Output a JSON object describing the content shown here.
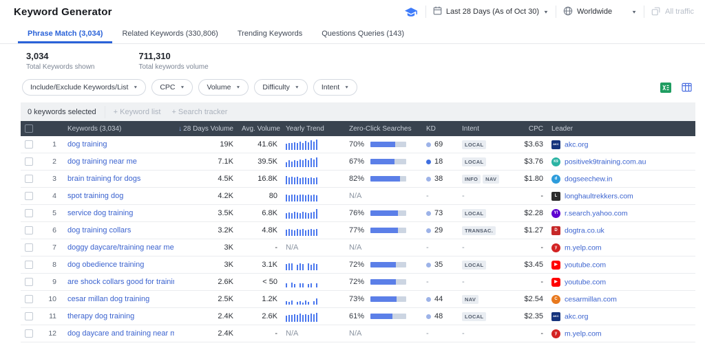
{
  "header": {
    "title": "Keyword Generator",
    "date_range": "Last 28 Days (As of Oct 30)",
    "location": "Worldwide",
    "traffic_filter": "All traffic"
  },
  "tabs": [
    {
      "label": "Phrase Match (3,034)",
      "active": true
    },
    {
      "label": "Related Keywords (330,806)",
      "active": false
    },
    {
      "label": "Trending Keywords",
      "active": false
    },
    {
      "label": "Questions Queries (143)",
      "active": false
    }
  ],
  "stats": [
    {
      "value": "3,034",
      "label": "Total Keywords shown"
    },
    {
      "value": "711,310",
      "label": "Total keywords volume"
    }
  ],
  "filters": [
    {
      "label": "Include/Exclude Keywords/List"
    },
    {
      "label": "CPC"
    },
    {
      "label": "Volume"
    },
    {
      "label": "Difficulty"
    },
    {
      "label": "Intent"
    }
  ],
  "selection": {
    "status": "0 keywords selected",
    "actions": [
      {
        "label": "+ Keyword list"
      },
      {
        "label": "+ Search tracker"
      }
    ]
  },
  "table": {
    "columns": {
      "keywords": "Keywords (3,034)",
      "vol_28d": "28 Days Volume",
      "avg_volume": "Avg. Volume",
      "yearly_trend": "Yearly Trend",
      "zero_click": "Zero-Click Searches",
      "kd": "KD",
      "intent": "Intent",
      "cpc": "CPC",
      "leader": "Leader"
    },
    "rows": [
      {
        "num": "1",
        "keyword": "dog training",
        "vol_28d": "19K",
        "avg_volume": "41.6K",
        "trend": [
          55,
          65,
          60,
          70,
          60,
          75,
          65,
          80,
          70,
          85,
          75,
          95
        ],
        "zero_click": "70%",
        "zc_pct": 70,
        "kd": "69",
        "kd_color": "#9db3e8",
        "intents": [
          "LOCAL"
        ],
        "cpc": "$3.63",
        "leader": "akc.org",
        "favicon": {
          "bg": "#16347c",
          "fg": "#ffffff",
          "glyph": "AKC",
          "shape": "square",
          "font_size": "4px"
        }
      },
      {
        "num": "2",
        "keyword": "dog training near me",
        "vol_28d": "7.1K",
        "avg_volume": "39.5K",
        "trend": [
          45,
          60,
          50,
          65,
          55,
          70,
          60,
          75,
          65,
          80,
          70,
          85
        ],
        "zero_click": "67%",
        "zc_pct": 67,
        "kd": "18",
        "kd_color": "#3f6fe0",
        "intents": [
          "LOCAL"
        ],
        "cpc": "$3.76",
        "leader": "positivek9training.com.au",
        "favicon": {
          "bg": "#2bb3a3",
          "fg": "#ffffff",
          "glyph": "K9",
          "shape": "circle",
          "font_size": "5px"
        }
      },
      {
        "num": "3",
        "keyword": "brain training for dogs",
        "vol_28d": "4.5K",
        "avg_volume": "16.8K",
        "trend": [
          75,
          65,
          70,
          60,
          70,
          55,
          65,
          60,
          55,
          65,
          55,
          60
        ],
        "zero_click": "82%",
        "zc_pct": 82,
        "kd": "38",
        "kd_color": "#9db3e8",
        "intents": [
          "INFO",
          "NAV"
        ],
        "cpc": "$1.80",
        "leader": "dogseechew.in",
        "favicon": {
          "bg": "#2d9cdb",
          "fg": "#ffffff",
          "glyph": "d",
          "shape": "circle"
        }
      },
      {
        "num": "4",
        "keyword": "spot training dog",
        "vol_28d": "4.2K",
        "avg_volume": "80",
        "trend": [
          60,
          55,
          65,
          60,
          55,
          60,
          65,
          55,
          60,
          55,
          60,
          55
        ],
        "zero_click": null,
        "zc_pct": null,
        "kd": null,
        "intents": [],
        "cpc": "-",
        "leader": "longhaultrekkers.com",
        "favicon": {
          "bg": "#2b2b2b",
          "fg": "#ffffff",
          "glyph": "L",
          "shape": "square"
        }
      },
      {
        "num": "5",
        "keyword": "service dog training",
        "vol_28d": "3.5K",
        "avg_volume": "6.8K",
        "trend": [
          50,
          55,
          50,
          60,
          55,
          50,
          60,
          55,
          50,
          55,
          60,
          85
        ],
        "zero_click": "76%",
        "zc_pct": 76,
        "kd": "73",
        "kd_color": "#9db3e8",
        "intents": [
          "LOCAL"
        ],
        "cpc": "$2.28",
        "leader": "r.search.yahoo.com",
        "favicon": {
          "bg": "#5f01d1",
          "fg": "#ffffff",
          "glyph": "Y!",
          "shape": "circle"
        }
      },
      {
        "num": "6",
        "keyword": "dog training collars",
        "vol_28d": "3.2K",
        "avg_volume": "4.8K",
        "trend": [
          55,
          60,
          55,
          50,
          60,
          55,
          60,
          50,
          55,
          60,
          55,
          60
        ],
        "zero_click": "77%",
        "zc_pct": 77,
        "kd": "29",
        "kd_color": "#9db3e8",
        "intents": [
          "TRANSAC."
        ],
        "cpc": "$1.27",
        "leader": "dogtra.co.uk",
        "favicon": {
          "bg": "#c62828",
          "fg": "#ffffff",
          "glyph": "D",
          "shape": "square"
        }
      },
      {
        "num": "7",
        "keyword": "doggy daycare/training near me",
        "vol_28d": "3K",
        "avg_volume": "-",
        "trend": null,
        "zero_click": null,
        "zc_pct": null,
        "kd": null,
        "intents": [],
        "cpc": "-",
        "leader": "m.yelp.com",
        "favicon": {
          "bg": "#d32323",
          "fg": "#ffffff",
          "glyph": "y",
          "shape": "circle"
        }
      },
      {
        "num": "8",
        "keyword": "dog obedience training",
        "vol_28d": "3K",
        "avg_volume": "3.1K",
        "trend": [
          55,
          65,
          60,
          0,
          50,
          60,
          55,
          0,
          60,
          50,
          65,
          55
        ],
        "zero_click": "72%",
        "zc_pct": 72,
        "kd": "35",
        "kd_color": "#9db3e8",
        "intents": [
          "LOCAL"
        ],
        "cpc": "$3.45",
        "leader": "youtube.com",
        "favicon": {
          "bg": "#ff0000",
          "fg": "#ffffff",
          "glyph": "▶",
          "shape": "rounded"
        }
      },
      {
        "num": "9",
        "keyword": "are shock collars good for training ...",
        "vol_28d": "2.6K",
        "avg_volume": "< 50",
        "trend": [
          35,
          0,
          45,
          30,
          0,
          40,
          35,
          0,
          30,
          40,
          0,
          35
        ],
        "zero_click": "72%",
        "zc_pct": 72,
        "kd": null,
        "intents": [],
        "cpc": "-",
        "leader": "youtube.com",
        "favicon": {
          "bg": "#ff0000",
          "fg": "#ffffff",
          "glyph": "▶",
          "shape": "rounded"
        }
      },
      {
        "num": "10",
        "keyword": "cesar millan dog training",
        "vol_28d": "2.5K",
        "avg_volume": "1.2K",
        "trend": [
          30,
          25,
          35,
          0,
          25,
          30,
          20,
          35,
          25,
          0,
          30,
          55
        ],
        "zero_click": "73%",
        "zc_pct": 73,
        "kd": "44",
        "kd_color": "#9db3e8",
        "intents": [
          "NAV"
        ],
        "cpc": "$2.54",
        "leader": "cesarmillan.com",
        "favicon": {
          "bg": "#e8791e",
          "fg": "#ffffff",
          "glyph": "C",
          "shape": "circle"
        }
      },
      {
        "num": "11",
        "keyword": "therapy dog training",
        "vol_28d": "2.4K",
        "avg_volume": "2.6K",
        "trend": [
          55,
          65,
          60,
          70,
          65,
          75,
          60,
          70,
          65,
          75,
          70,
          80
        ],
        "zero_click": "61%",
        "zc_pct": 61,
        "kd": "48",
        "kd_color": "#9db3e8",
        "intents": [
          "LOCAL"
        ],
        "cpc": "$2.35",
        "leader": "akc.org",
        "favicon": {
          "bg": "#16347c",
          "fg": "#ffffff",
          "glyph": "AKC",
          "shape": "square",
          "font_size": "4px"
        }
      },
      {
        "num": "12",
        "keyword": "dog daycare and training near me ...",
        "vol_28d": "2.4K",
        "avg_volume": "-",
        "trend": null,
        "zero_click": null,
        "zc_pct": null,
        "kd": null,
        "intents": [],
        "cpc": "-",
        "leader": "m.yelp.com",
        "favicon": {
          "bg": "#d32323",
          "fg": "#ffffff",
          "glyph": "y",
          "shape": "circle"
        }
      }
    ]
  },
  "colors": {
    "accent_blue": "#2a62d8",
    "trend_bar": "#4a77ee",
    "zero_click_fill": "#5b7fe8",
    "zero_click_rest": "#ccd5e2",
    "table_header_bg": "#39434f"
  }
}
